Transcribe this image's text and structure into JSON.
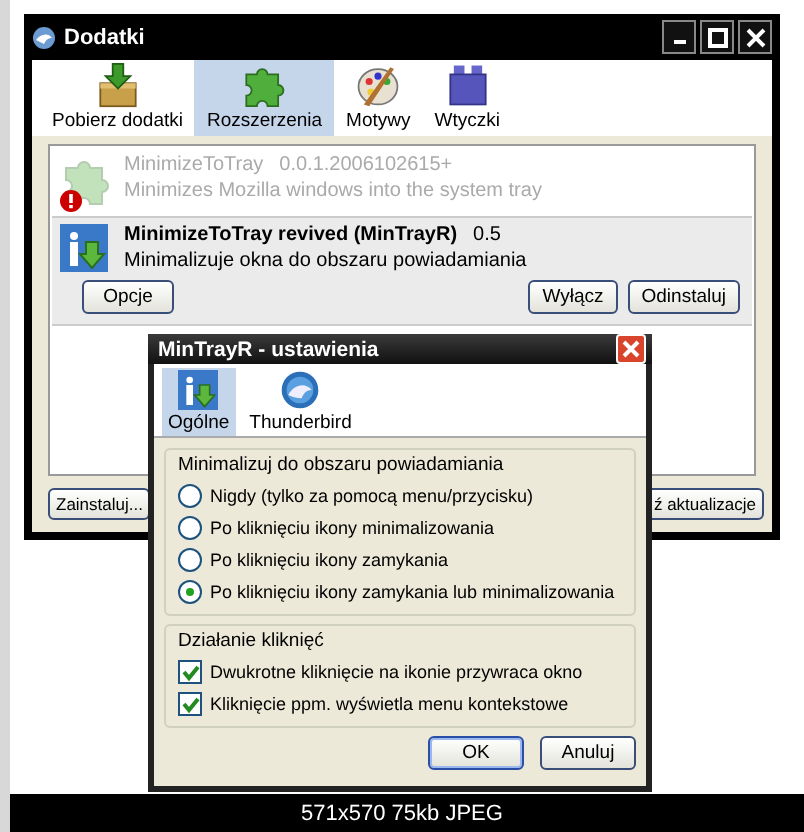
{
  "window": {
    "title": "Dodatki"
  },
  "toolbar": [
    {
      "label": "Pobierz dodatki",
      "kind": "download",
      "selected": false
    },
    {
      "label": "Rozszerzenia",
      "kind": "puzzle",
      "selected": true
    },
    {
      "label": "Motywy",
      "kind": "palette",
      "selected": false
    },
    {
      "label": "Wtyczki",
      "kind": "plugin",
      "selected": false
    }
  ],
  "extensions": [
    {
      "name": "MinimizeToTray",
      "version": "0.0.1.2006102615+",
      "description": "Minimizes Mozilla windows into the system tray",
      "kind": "puzzle",
      "disabled": true,
      "error": true,
      "selected": false
    },
    {
      "name": "MinimizeToTray revived (MinTrayR)",
      "version": "0.5",
      "description": "Minimalizuje okna do obszaru powiadamiania",
      "kind": "info",
      "disabled": false,
      "error": false,
      "selected": true,
      "buttons": [
        "Opcje",
        "Wyłącz",
        "Odinstaluj"
      ]
    }
  ],
  "bottom_buttons": [
    "Zainstaluj...",
    "ź aktualizacje"
  ],
  "dialog": {
    "title": "MinTrayR - ustawienia",
    "tabs": [
      {
        "label": "Ogólne",
        "kind": "info",
        "selected": true
      },
      {
        "label": "Thunderbird",
        "kind": "bird",
        "selected": false
      }
    ],
    "groups": [
      {
        "title": "Minimalizuj do obszaru powiadamiania",
        "kind": "radio",
        "options": [
          {
            "label": "Nigdy (tylko za pomocą menu/przycisku)",
            "selected": false
          },
          {
            "label": "Po kliknięciu ikony minimalizowania",
            "selected": false
          },
          {
            "label": "Po kliknięciu ikony zamykania",
            "selected": false
          },
          {
            "label": "Po kliknięciu ikony zamykania lub minimalizowania",
            "selected": true
          }
        ]
      },
      {
        "title": "Działanie kliknięć",
        "kind": "checkbox",
        "options": [
          {
            "label": "Dwukrotne kliknięcie na ikonie przywraca okno",
            "checked": true
          },
          {
            "label": "Kliknięcie ppm. wyświetla menu kontekstowe",
            "checked": true
          }
        ]
      }
    ],
    "buttons": [
      "OK",
      "Anuluj"
    ]
  },
  "caption": "571x570 75kb JPEG"
}
